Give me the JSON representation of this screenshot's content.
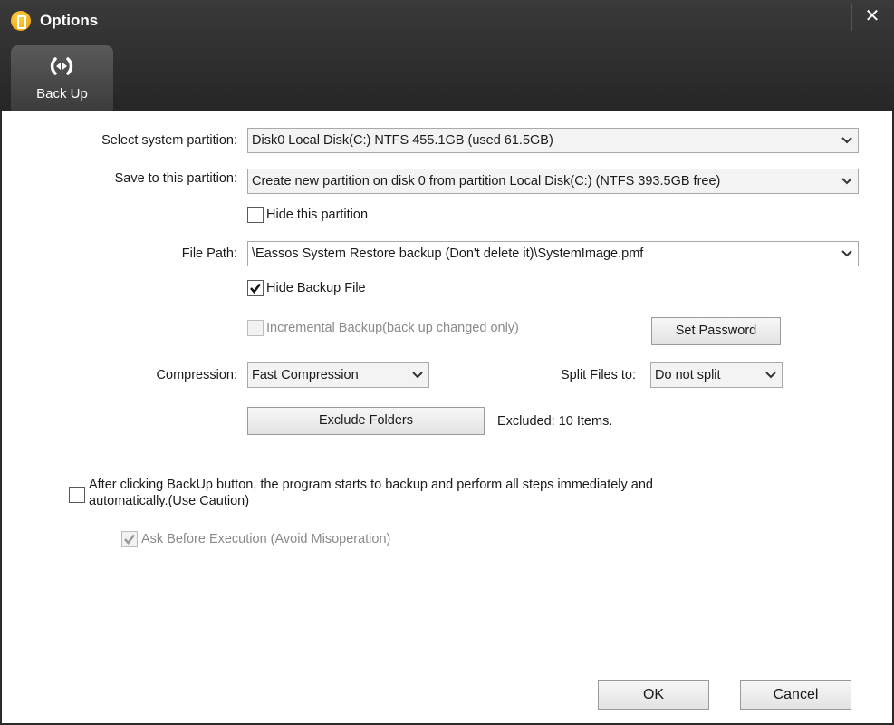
{
  "window": {
    "title": "Options",
    "close_glyph": "✕"
  },
  "tabs": [
    {
      "label": "Back Up",
      "icon": "backup-arrows-icon"
    }
  ],
  "form": {
    "system_partition": {
      "label": "Select system partition:",
      "value": "Disk0  Local Disk(C:) NTFS 455.1GB (used 61.5GB)"
    },
    "save_partition": {
      "label": "Save to this partition:",
      "value": "Create new partition on disk 0 from partition Local Disk(C:) (NTFS 393.5GB free)"
    },
    "hide_partition": {
      "label": "Hide this partition",
      "checked": false
    },
    "file_path": {
      "label": "File Path:",
      "value": "\\Eassos System Restore backup (Don't delete it)\\SystemImage.pmf"
    },
    "hide_backup_file": {
      "label": "Hide Backup File",
      "checked": true
    },
    "incremental_backup": {
      "label": "Incremental Backup(back up changed only)",
      "checked": false,
      "disabled": true
    },
    "set_password": {
      "label": "Set Password"
    },
    "compression": {
      "label": "Compression:",
      "value": "Fast Compression"
    },
    "split_files": {
      "label": "Split Files to:",
      "value": "Do not split"
    },
    "exclude_folders": {
      "label": "Exclude Folders"
    },
    "excluded_status": "Excluded: 10 Items.",
    "auto_execute": {
      "label_line1": "After clicking BackUp button, the program starts to backup and perform all steps immediately and",
      "label_line2": "automatically.(Use Caution)",
      "checked": false
    },
    "ask_before": {
      "label": "Ask Before Execution (Avoid Misoperation)",
      "checked": true,
      "disabled": true
    }
  },
  "buttons": {
    "ok": "OK",
    "cancel": "Cancel"
  },
  "colors": {
    "titlebar": "#2b2b2b",
    "tab": "#4a4a4a",
    "app_icon": "#f5b400"
  }
}
